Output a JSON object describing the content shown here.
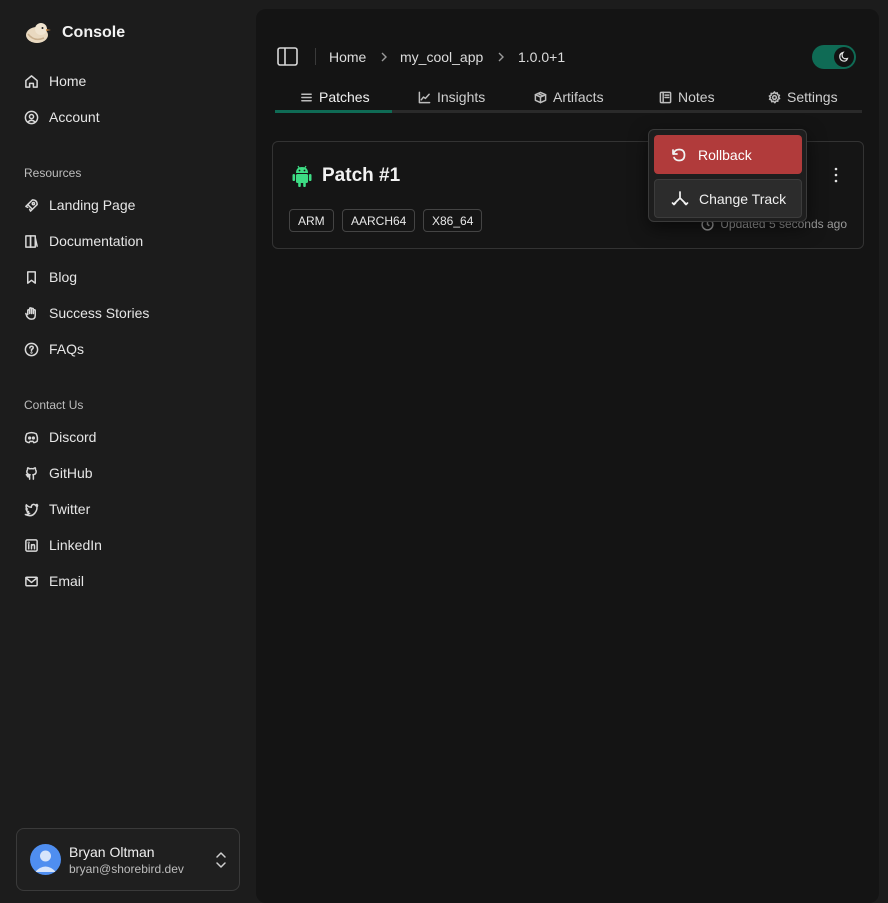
{
  "brand": {
    "name": "Console"
  },
  "nav": {
    "main": [
      {
        "label": "Home",
        "icon": "home-icon"
      },
      {
        "label": "Account",
        "icon": "account-icon"
      }
    ],
    "resources_label": "Resources",
    "resources": [
      {
        "label": "Landing Page",
        "icon": "rocket-icon"
      },
      {
        "label": "Documentation",
        "icon": "book-icon"
      },
      {
        "label": "Blog",
        "icon": "bookmark-icon"
      },
      {
        "label": "Success Stories",
        "icon": "hand-icon"
      },
      {
        "label": "FAQs",
        "icon": "help-circle-icon"
      }
    ],
    "contact_label": "Contact Us",
    "contact": [
      {
        "label": "Discord",
        "icon": "discord-icon"
      },
      {
        "label": "GitHub",
        "icon": "github-icon"
      },
      {
        "label": "Twitter",
        "icon": "twitter-icon"
      },
      {
        "label": "LinkedIn",
        "icon": "linkedin-icon"
      },
      {
        "label": "Email",
        "icon": "mail-icon"
      }
    ]
  },
  "user": {
    "name": "Bryan Oltman",
    "email": "bryan@shorebird.dev"
  },
  "breadcrumb": [
    "Home",
    "my_cool_app",
    "1.0.0+1"
  ],
  "tabs": [
    {
      "label": "Patches",
      "icon": "list-icon",
      "active": true
    },
    {
      "label": "Insights",
      "icon": "chart-icon"
    },
    {
      "label": "Artifacts",
      "icon": "package-icon"
    },
    {
      "label": "Notes",
      "icon": "notes-icon"
    },
    {
      "label": "Settings",
      "icon": "gear-icon"
    }
  ],
  "patch": {
    "title": "Patch #1",
    "tags": [
      "ARM",
      "AARCH64",
      "X86_64"
    ],
    "updated": "Updated 5 seconds ago"
  },
  "menu": {
    "rollback": "Rollback",
    "change_track": "Change Track"
  },
  "colors": {
    "accent": "#0f6b55",
    "danger": "#b13b3b",
    "android": "#3ddc84"
  }
}
